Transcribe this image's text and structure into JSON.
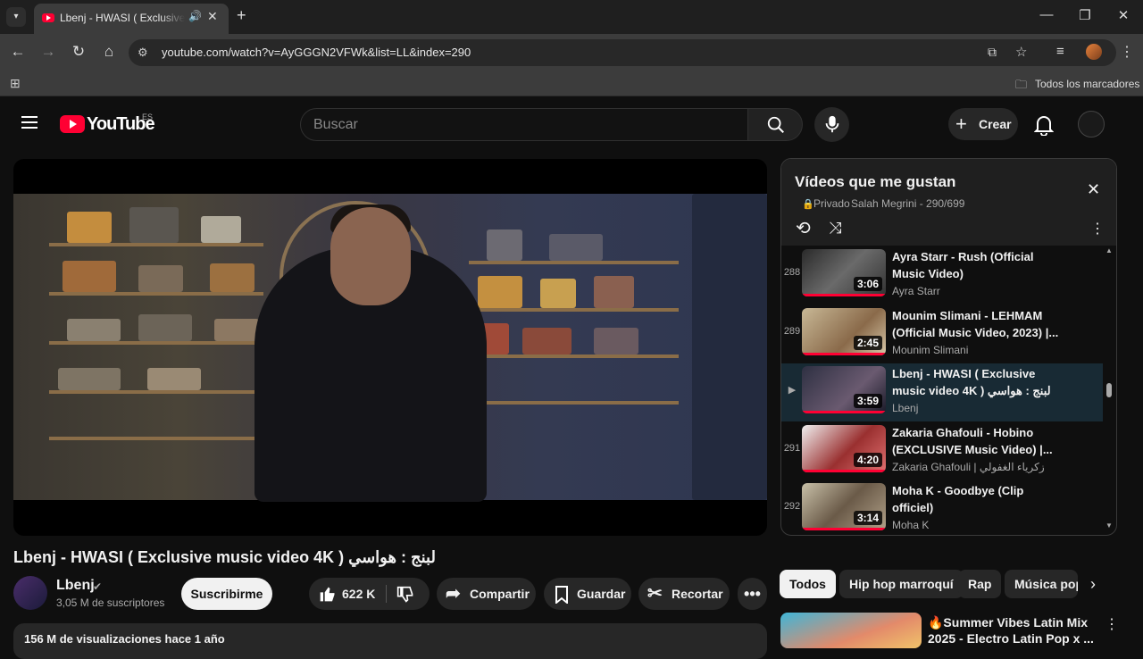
{
  "browser": {
    "tab_title": "Lbenj - HWASI ( Exclusive m",
    "url": "youtube.com/watch?v=AyGGGN2VFWk&list=LL&index=290",
    "bookmarks_label": "Todos los marcadores"
  },
  "header": {
    "logo_text": "YouTube",
    "country": "ES",
    "search_placeholder": "Buscar",
    "create_label": "Crear"
  },
  "video": {
    "title": "Lbenj - HWASI ( Exclusive music video 4K ) لبنج : هواسي",
    "channel": "Lbenj",
    "subscribers": "3,05 M de suscriptores",
    "subscribe_label": "Suscribirme",
    "likes": "622 K",
    "share_label": "Compartir",
    "save_label": "Guardar",
    "clip_label": "Recortar",
    "desc_meta": "156 M de visualizaciones  hace 1 año"
  },
  "playlist": {
    "title": "Vídeos que me gustan",
    "privacy": "Privado",
    "owner_count": "Salah Megrini - 290/699",
    "items": [
      {
        "index": "288",
        "title": "Ayra Starr - Rush (Official Music Video)",
        "channel": "Ayra Starr",
        "duration": "3:06",
        "active": false
      },
      {
        "index": "289",
        "title": "Mounim Slimani - LEHMAM (Official Music Video, 2023) |...",
        "channel": "Mounim Slimani",
        "duration": "2:45",
        "active": false
      },
      {
        "index": "▶",
        "title": "Lbenj - HWASI ( Exclusive music video 4K ) لبنج : هواسي",
        "channel": "Lbenj",
        "duration": "3:59",
        "active": true
      },
      {
        "index": "291",
        "title": "Zakaria Ghafouli - Hobino (EXCLUSIVE Music Video) |...",
        "channel": "Zakaria Ghafouli | زكرياء الغفولي",
        "duration": "4:20",
        "active": false
      },
      {
        "index": "292",
        "title": "Moha K - Goodbye (Clip officiel)",
        "channel": "Moha K",
        "duration": "3:14",
        "active": false
      }
    ]
  },
  "chips": [
    "Todos",
    "Hip hop marroquí",
    "Rap",
    "Música pop"
  ],
  "recommendation": {
    "title": "🔥Summer Vibes Latin Mix 2025 - Electro Latin Pop x ..."
  },
  "colors": {
    "brand_red": "#ff0033",
    "background": "#0f0f0f"
  }
}
